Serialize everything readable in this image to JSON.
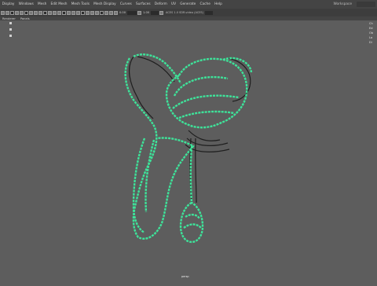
{
  "menubar": {
    "items": [
      "Display",
      "Windows",
      "Mesh",
      "Edit Mesh",
      "Mesh Tools",
      "Mesh Display",
      "Curves",
      "Surfaces",
      "Deform",
      "UV",
      "Generate",
      "Cache",
      "Help"
    ],
    "workspace_label": "Workspace"
  },
  "toolbar": {
    "value_a": "0.00",
    "value_b": "1.00",
    "colorspace_label": "ACES 1.0 SDR-video (ACES)"
  },
  "subbar": {
    "items": [
      "Renderer",
      "Panels"
    ]
  },
  "right_panel": {
    "labels": [
      "Ch",
      "Ed",
      "Ob",
      "La",
      "Di"
    ]
  },
  "viewport": {
    "camera_label": "persp",
    "wire_color": "#3ee39a",
    "shadow_color": "#1f1f1f"
  }
}
